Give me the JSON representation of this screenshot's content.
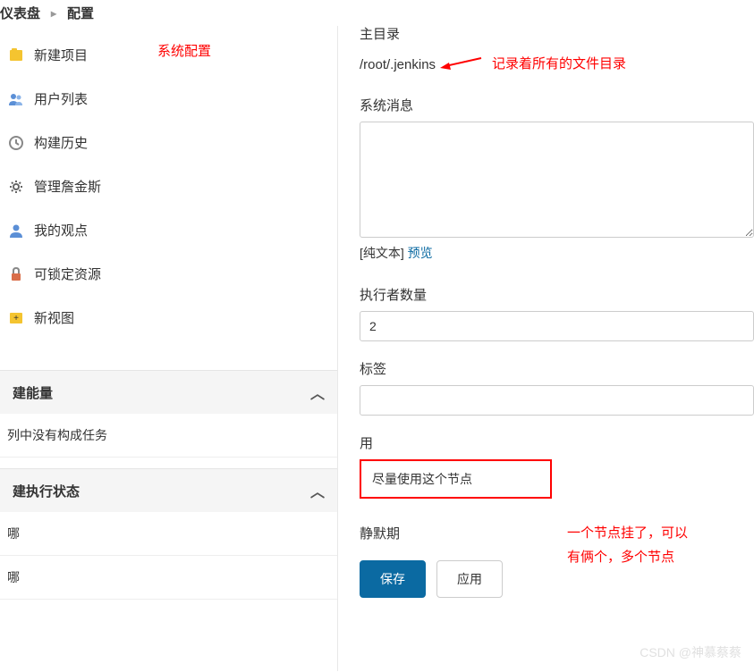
{
  "breadcrumb": {
    "item1": "仪表盘",
    "item2": "配置"
  },
  "annotations": {
    "system_config": "系统配置",
    "file_dir": "记录着所有的文件目录",
    "node_note_line1": "一个节点挂了，可以",
    "node_note_line2": "有俩个，多个节点"
  },
  "sidebar": {
    "items": [
      {
        "icon": "➕",
        "label": "新建项目"
      },
      {
        "icon": "👥",
        "label": "用户列表"
      },
      {
        "icon": "🛠️",
        "label": "构建历史"
      },
      {
        "icon": "⚙️",
        "label": "管理詹金斯"
      },
      {
        "icon": "👤",
        "label": "我的观点"
      },
      {
        "icon": "🔒",
        "label": "可锁定资源"
      },
      {
        "icon": "➕",
        "label": "新视图"
      }
    ],
    "section1": {
      "title": "建能量",
      "subitem": "列中没有构成任务"
    },
    "section2": {
      "title": "建执行状态",
      "subitem1": "哪",
      "subitem2": "哪"
    }
  },
  "form": {
    "home_dir_label": "主目录",
    "home_dir_value": "/root/.jenkins",
    "system_msg_label": "系统消息",
    "textarea_plain": "[纯文本]",
    "preview_label": "预览",
    "executors_label": "执行者数量",
    "executors_value": "2",
    "labels_label": "标签",
    "labels_value": "",
    "usage_label": "用",
    "usage_value": "尽量使用这个节点",
    "quiet_label": "静默期"
  },
  "buttons": {
    "save": "保存",
    "apply": "应用"
  },
  "watermark": "CSDN @神慕蔡蔡"
}
